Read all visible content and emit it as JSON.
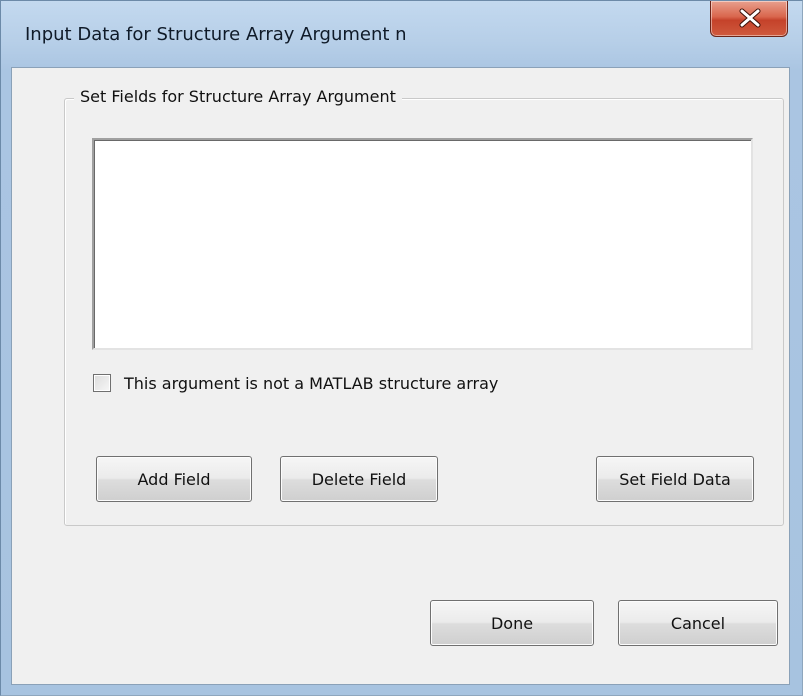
{
  "window": {
    "title": "Input Data for Structure Array Argument n"
  },
  "titlebar": {
    "close_icon": "close-x-icon",
    "close_color": "#c5422a"
  },
  "group": {
    "label": "Set Fields for Structure Array Argument"
  },
  "fields_list": {
    "items": []
  },
  "checkbox": {
    "label": "This argument is not a MATLAB structure array",
    "checked": false
  },
  "buttons": {
    "add_field": "Add Field",
    "delete_field": "Delete Field",
    "set_field_data": "Set Field Data",
    "done": "Done",
    "cancel": "Cancel"
  }
}
